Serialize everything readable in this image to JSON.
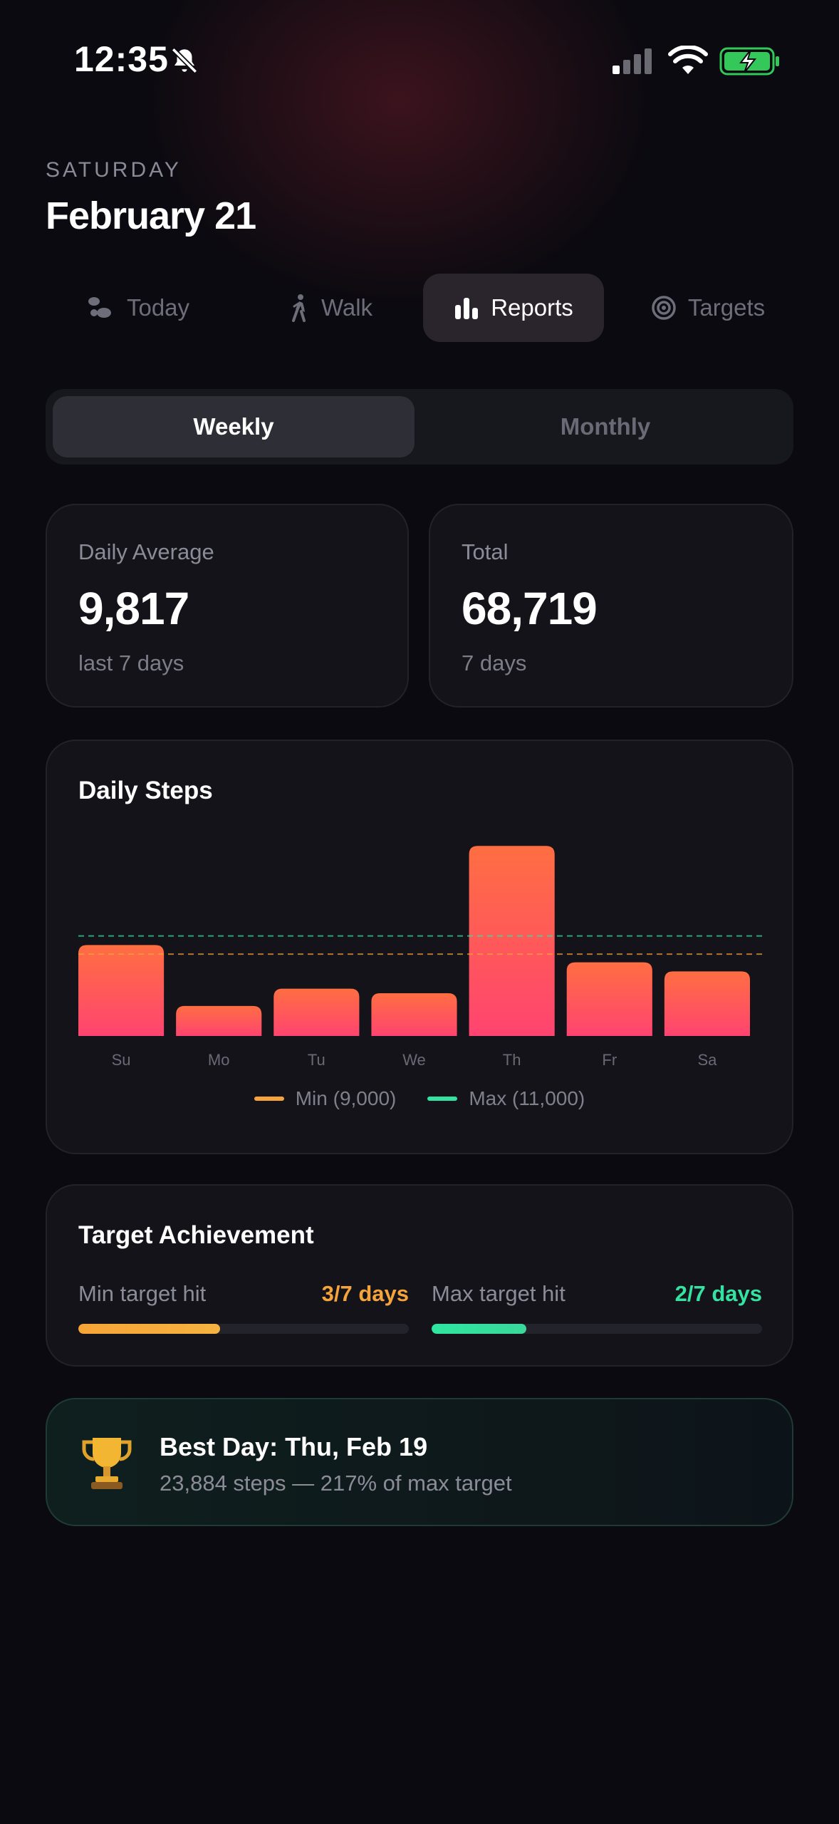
{
  "status_bar": {
    "time": "12:35",
    "icons": [
      "bell-slash-icon",
      "cellular-signal-icon",
      "wifi-icon",
      "battery-charging-icon"
    ],
    "battery_color": "#34c759"
  },
  "header": {
    "day": "SATURDAY",
    "date": "February 21"
  },
  "nav": {
    "items": [
      {
        "label": "Today",
        "icon": "footprints-icon",
        "active": false
      },
      {
        "label": "Walk",
        "icon": "walking-person-icon",
        "active": false
      },
      {
        "label": "Reports",
        "icon": "bar-chart-icon",
        "active": true
      },
      {
        "label": "Targets",
        "icon": "target-icon",
        "active": false
      }
    ]
  },
  "period_toggle": {
    "options": [
      "Weekly",
      "Monthly"
    ],
    "selected": "Weekly"
  },
  "stats": {
    "daily_average": {
      "label": "Daily Average",
      "value": "9,817",
      "sub": "last 7 days"
    },
    "total": {
      "label": "Total",
      "value": "68,719",
      "sub": "7 days"
    }
  },
  "daily_steps": {
    "title": "Daily Steps",
    "legend": {
      "min": "Min (9,000)",
      "max": "Max (11,000)"
    }
  },
  "chart_data": {
    "type": "bar",
    "categories": [
      "Su",
      "Mo",
      "Tu",
      "We",
      "Th",
      "Fr",
      "Sa"
    ],
    "values": [
      10000,
      3300,
      5200,
      4700,
      20900,
      8100,
      7100
    ],
    "ylim": [
      0,
      21000
    ],
    "reference_lines": [
      {
        "name": "Min (9,000)",
        "value": 9000,
        "color": "#f5a33b"
      },
      {
        "name": "Max (11,000)",
        "value": 11000,
        "color": "#34e3a1"
      }
    ],
    "bar_gradient": [
      "#ff6e42",
      "#ff4470"
    ],
    "grid": false,
    "legend_position": "bottom-center"
  },
  "target_achievement": {
    "title": "Target Achievement",
    "min": {
      "label": "Min target hit",
      "value": "3/7 days",
      "progress": 0.4286,
      "color": "#f5a33b"
    },
    "max": {
      "label": "Max target hit",
      "value": "2/7 days",
      "progress": 0.2857,
      "color": "#34e3a1"
    }
  },
  "best_day": {
    "icon": "trophy-icon",
    "title": "Best Day: Thu, Feb 19",
    "subtitle": "23,884 steps — 217% of max target"
  }
}
